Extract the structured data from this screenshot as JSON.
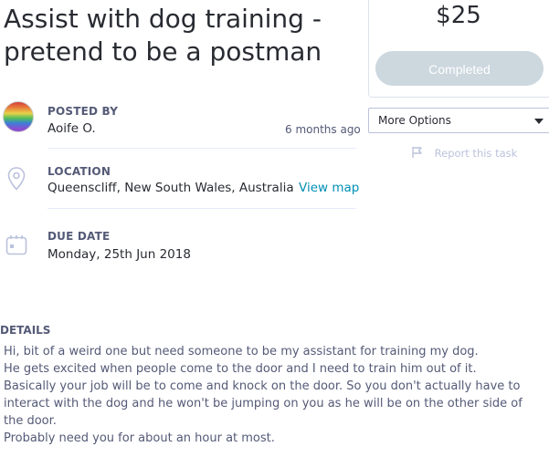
{
  "task": {
    "title": "Assist with dog training - pretend to be a postman",
    "posted_by_label": "POSTED BY",
    "poster_name": "Aoife O.",
    "posted_time": "6 months ago",
    "location_label": "LOCATION",
    "location": "Queenscliff, New South Wales, Australia",
    "view_map": "View map",
    "due_date_label": "DUE DATE",
    "due_date": "Monday, 25th Jun 2018"
  },
  "panel": {
    "price": "$25",
    "status_button": "Completed",
    "more_options": "More Options",
    "report": "Report this task"
  },
  "details": {
    "heading": "DETAILS",
    "lines": [
      "Hi, bit of a weird one but need someone to be my assistant for training my dog.",
      "He gets excited when people come to the door and I need to train him out of it.",
      "Basically your job will be to come and knock on the door. So you don't actually have to interact with the dog and he won't be jumping on you as he will be on the other side of the door.",
      "Probably need you for about an hour at most."
    ]
  },
  "icons": {
    "location": "map-pin-icon",
    "calendar": "calendar-icon",
    "report": "flag-icon",
    "dropdown": "caret-down-icon"
  },
  "colors": {
    "link": "#008fb4",
    "completed_button": "#ccd7de",
    "muted_text": "#545a77"
  }
}
